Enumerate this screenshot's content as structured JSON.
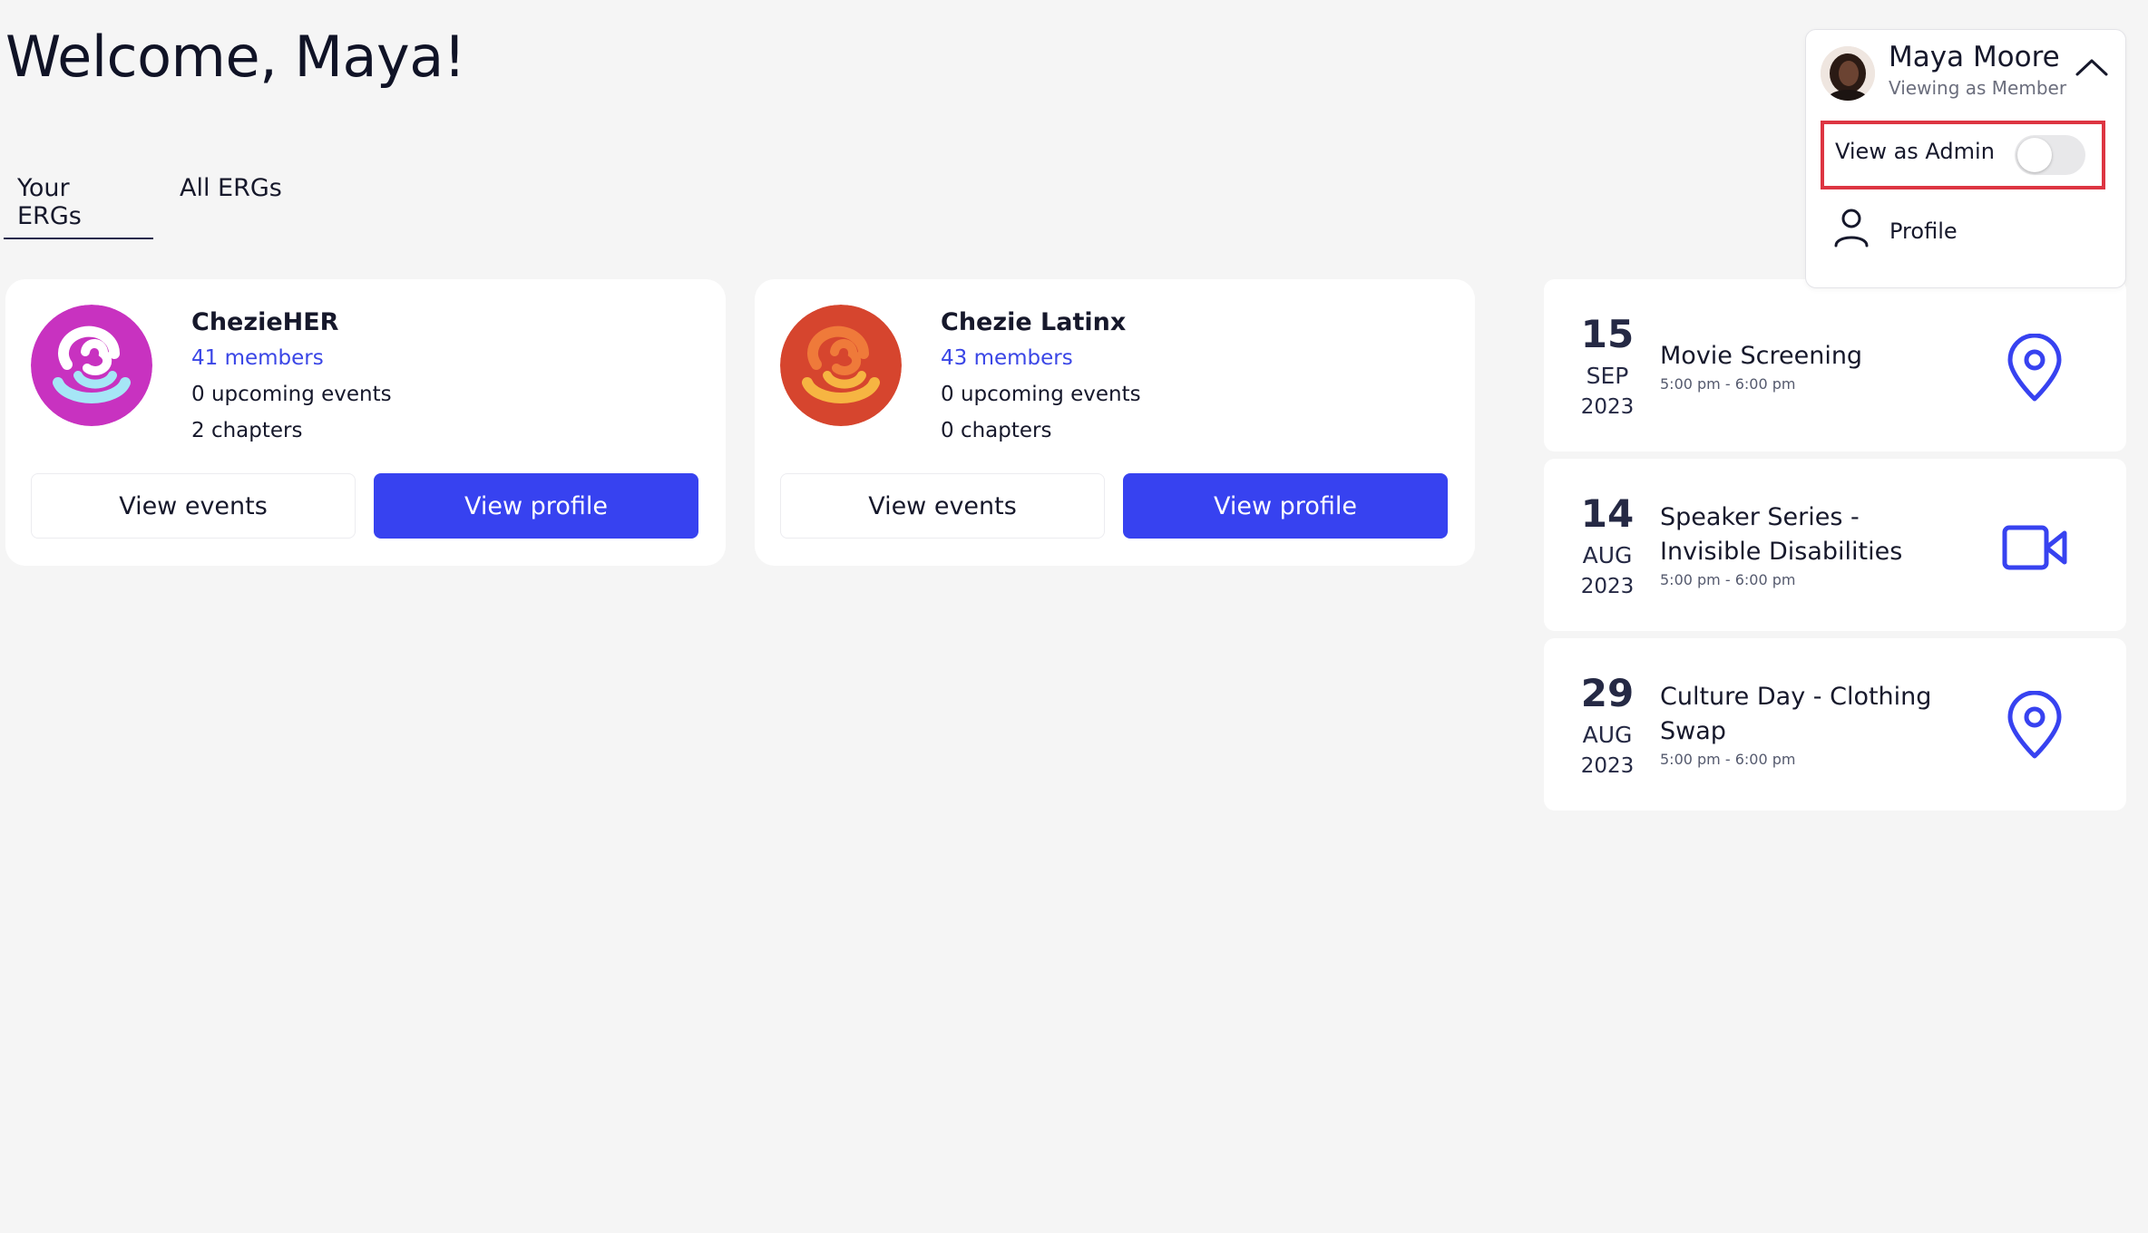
{
  "header": {
    "welcome": "Welcome, Maya!"
  },
  "tabs": [
    {
      "label": "Your ERGs",
      "active": true
    },
    {
      "label": "All ERGs",
      "active": false
    }
  ],
  "ergs": [
    {
      "name": "ChezieHER",
      "members": "41 members",
      "upcoming": "0 upcoming events",
      "chapters": "2 chapters",
      "view_events": "View events",
      "view_profile": "View profile",
      "logo_colors": {
        "bg": "#c832c0",
        "top": "#ffffff",
        "bottom": "#a6e6f6"
      }
    },
    {
      "name": "Chezie Latinx",
      "members": "43 members",
      "upcoming": "0 upcoming events",
      "chapters": "0 chapters",
      "view_events": "View events",
      "view_profile": "View profile",
      "logo_colors": {
        "bg": "#d6452e",
        "top": "#ef7a3a",
        "bottom": "#f6b542"
      }
    }
  ],
  "events": [
    {
      "day": "15",
      "month": "SEP",
      "year": "2023",
      "title": "Movie Screening",
      "time": "5:00 pm - 6:00 pm",
      "icon": "location-pin-icon"
    },
    {
      "day": "14",
      "month": "AUG",
      "year": "2023",
      "title": "Speaker Series - Invisible Disabilities",
      "time": "5:00 pm - 6:00 pm",
      "icon": "video-camera-icon"
    },
    {
      "day": "29",
      "month": "AUG",
      "year": "2023",
      "title": "Culture Day - Clothing Swap",
      "time": "5:00 pm - 6:00 pm",
      "icon": "location-pin-icon"
    }
  ],
  "user_menu": {
    "name": "Maya Moore",
    "role": "Viewing as Member",
    "view_as_admin_label": "View as Admin",
    "view_as_admin_on": false,
    "profile_label": "Profile"
  },
  "colors": {
    "accent": "#3742f0",
    "link": "#3a46e6",
    "highlight": "#dd3542",
    "background": "#f5f5f5"
  }
}
